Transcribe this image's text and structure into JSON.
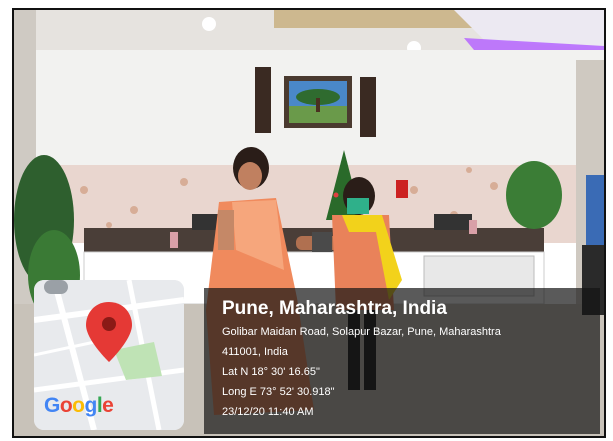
{
  "location": {
    "place": "Pune, Maharashtra, India",
    "address_line1": "Golibar Maidan Road, Solapur Bazar, Pune, Maharashtra",
    "address_line2": "411001, India",
    "latitude": "Lat N 18° 30' 16.65\"",
    "longitude": "Long E 73° 52' 30.918\"",
    "timestamp": "23/12/20 11:40 AM"
  },
  "map": {
    "brand_text": "Google",
    "brand_letters": [
      "G",
      "o",
      "o",
      "g",
      "l",
      "e"
    ],
    "brand_colors": [
      "#4285F4",
      "#EA4335",
      "#FBBC05",
      "#4285F4",
      "#34A853",
      "#EA4335"
    ],
    "pin_icon": "map-pin-icon",
    "pin_color": "#E53935"
  },
  "colors": {
    "wall": "#f2f2f0",
    "wallpaper": "#e9d6cf",
    "ceiling_light": "#b565ff",
    "saree": "#f08a5d",
    "dupatta": "#f2d21b"
  }
}
